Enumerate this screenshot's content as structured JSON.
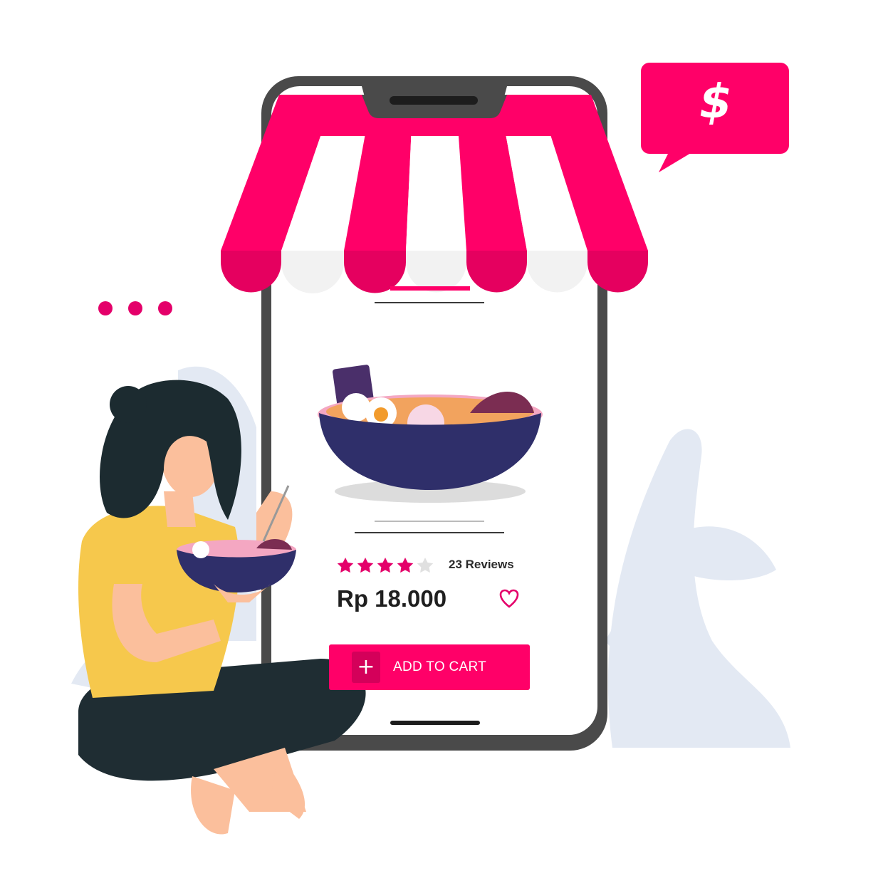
{
  "product": {
    "rating": 4,
    "rating_max": 5,
    "reviews_label": "23 Reviews",
    "price": "Rp 18.000",
    "add_to_cart_label": "ADD TO CART",
    "plus_glyph": "+"
  },
  "speech_bubble": {
    "symbol": "$",
    "icon": "dollar-icon"
  },
  "icons": [
    "star-icon",
    "heart-icon",
    "plus-icon",
    "ellipsis-icon",
    "dollar-icon"
  ],
  "colors": {
    "accent": "#ff0068",
    "accent_dark": "#d4005a",
    "phone_frame": "#4a4a4a",
    "bowl": "#2f2f6a",
    "shirt": "#f6c84c",
    "pants": "#1f2d33",
    "hair": "#1c2b30",
    "skin": "#fbbf9c",
    "leaf": "#dfe6f1"
  }
}
